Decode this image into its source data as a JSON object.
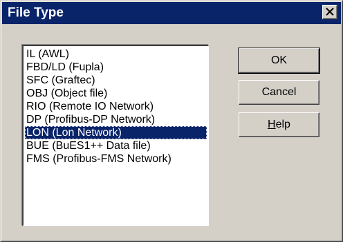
{
  "window": {
    "title": "File Type"
  },
  "listbox": {
    "items": [
      {
        "label": "IL (AWL)",
        "selected": false
      },
      {
        "label": "FBD/LD (Fupla)",
        "selected": false
      },
      {
        "label": "SFC (Graftec)",
        "selected": false
      },
      {
        "label": "OBJ (Object file)",
        "selected": false
      },
      {
        "label": "RIO (Remote IO Network)",
        "selected": false
      },
      {
        "label": "DP (Profibus-DP Network)",
        "selected": false
      },
      {
        "label": "LON (Lon Network)",
        "selected": true
      },
      {
        "label": "BUE (BuES1++ Data file)",
        "selected": false
      },
      {
        "label": "FMS (Profibus-FMS Network)",
        "selected": false
      }
    ]
  },
  "buttons": {
    "ok_label": "OK",
    "cancel_label": "Cancel",
    "help_mnemonic": "H",
    "help_rest": "elp"
  },
  "colors": {
    "titlebar": "#0a246a",
    "face": "#d4d0c8",
    "selection": "#0a246a"
  },
  "icons": {
    "close": "close-icon"
  }
}
